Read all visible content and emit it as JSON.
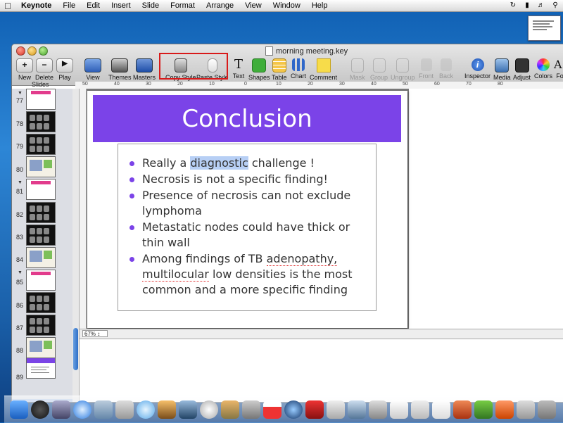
{
  "menubar": {
    "app": "Keynote",
    "items": [
      "File",
      "Edit",
      "Insert",
      "Slide",
      "Format",
      "Arrange",
      "View",
      "Window",
      "Help"
    ]
  },
  "window": {
    "title": "morning meeting.key"
  },
  "toolbar": {
    "new": "New",
    "delete": "Delete",
    "play": "Play",
    "view": "View",
    "themes": "Themes",
    "masters": "Masters",
    "copy_style": "Copy Style",
    "paste_style": "Paste Style",
    "text": "Text",
    "shapes": "Shapes",
    "table": "Table",
    "chart": "Chart",
    "comment": "Comment",
    "mask": "Mask",
    "group": "Group",
    "ungroup": "Ungroup",
    "front": "Front",
    "back": "Back",
    "inspector": "Inspector",
    "media": "Media",
    "adjust": "Adjust",
    "colors": "Colors",
    "fonts": "Fon"
  },
  "navigator": {
    "label": "Slides",
    "slides": [
      "77",
      "78",
      "79",
      "80",
      "81",
      "82",
      "83",
      "84",
      "85",
      "86",
      "87",
      "88",
      "89"
    ]
  },
  "ruler": {
    "ticks": [
      "50",
      "40",
      "30",
      "20",
      "10",
      "0",
      "10",
      "20",
      "30",
      "40",
      "50",
      "60",
      "70",
      "80"
    ]
  },
  "slide": {
    "title": "Conclusion",
    "bullets": {
      "b1_pre": "Really a ",
      "b1_hl": "diagnostic",
      "b1_post": " challenge !",
      "b2": "Necrosis is not a specific finding!",
      "b3": "Presence of necrosis can not exclude lymphoma",
      "b4": "Metastatic nodes could have thick or thin wall",
      "b5_pre": "Among findings of TB ",
      "b5_sp1": "adenopathy,",
      "b5_mid": " ",
      "b5_sp2": "multilocular",
      "b5_post": " low densities is the most common and a more specific finding"
    }
  },
  "zoom": "67%",
  "colors": {
    "title_band": "#7b43e8",
    "highlight_box": "#d81a1a"
  }
}
